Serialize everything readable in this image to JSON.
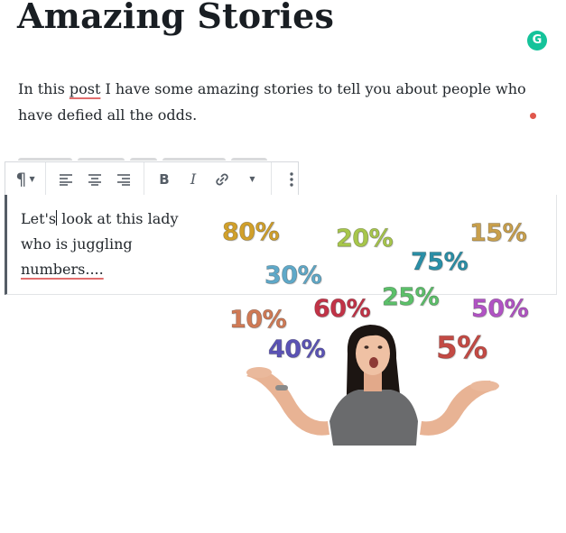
{
  "post": {
    "title": "Amazing Stories",
    "para_before": "In this ",
    "para_word": "post",
    "para_after": " I have some amazing stories to tell you about people who have defied all the odds."
  },
  "toolbar": {
    "paragraph_icon": "pilcrow-icon",
    "align_left_icon": "align-left-icon",
    "align_center_icon": "align-center-icon",
    "align_right_icon": "align-right-icon",
    "bold_label": "B",
    "italic_label": "I",
    "link_icon": "link-icon",
    "more_formatting_icon": "chevron-down-icon",
    "more_options_icon": "ellipsis-vertical-icon"
  },
  "block": {
    "text_start": "Let's",
    "text_mid": " look at this lady who is juggling ",
    "text_end": "numbers...."
  },
  "image": {
    "percentages": [
      {
        "label": "80%",
        "color": "#d1a02a"
      },
      {
        "label": "20%",
        "color": "#a7c64b"
      },
      {
        "label": "15%",
        "color": "#c9a04c"
      },
      {
        "label": "75%",
        "color": "#2a8fa7"
      },
      {
        "label": "30%",
        "color": "#5fa9c9"
      },
      {
        "label": "25%",
        "color": "#5cc06a"
      },
      {
        "label": "60%",
        "color": "#c23347"
      },
      {
        "label": "50%",
        "color": "#b153c4"
      },
      {
        "label": "10%",
        "color": "#d07a55"
      },
      {
        "label": "5%",
        "color": "#c34a44"
      },
      {
        "label": "40%",
        "color": "#5b53b5"
      }
    ]
  },
  "colors": {
    "grammarly": "#15c39a",
    "accent_red": "#e0574c"
  }
}
